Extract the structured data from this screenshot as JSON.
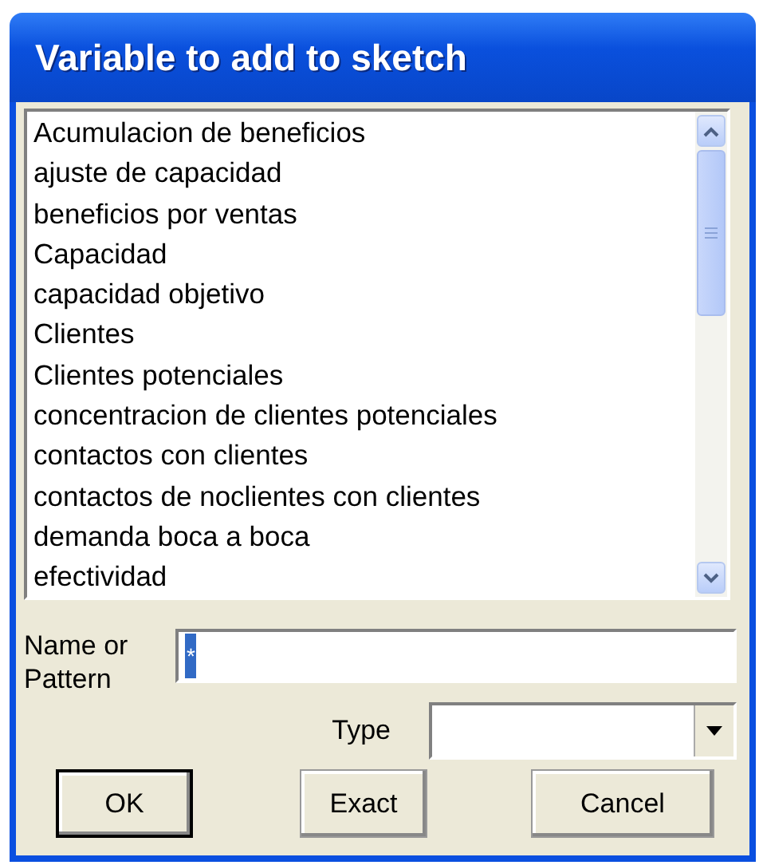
{
  "window": {
    "title": "Variable to add to sketch"
  },
  "variables": [
    {
      "label": "Acumulacion de beneficios",
      "selected": false
    },
    {
      "label": "ajuste de capacidad",
      "selected": false
    },
    {
      "label": "beneficios por ventas",
      "selected": false
    },
    {
      "label": "Capacidad",
      "selected": false
    },
    {
      "label": "capacidad objetivo",
      "selected": false
    },
    {
      "label": "Clientes",
      "selected": false
    },
    {
      "label": "Clientes potenciales",
      "selected": false
    },
    {
      "label": "concentracion de clientes potenciales",
      "selected": false
    },
    {
      "label": "contactos con clientes",
      "selected": false
    },
    {
      "label": "contactos de noclientes con clientes",
      "selected": false
    },
    {
      "label": "demanda boca a boca",
      "selected": false
    },
    {
      "label": "efectividad",
      "selected": false
    }
  ],
  "name_field": {
    "label": "Name or Pattern",
    "value": "*"
  },
  "type_field": {
    "label": "Type"
  },
  "buttons": [
    {
      "label": "OK",
      "default": true
    },
    {
      "label": "Exact",
      "default": false
    },
    {
      "label": "Cancel",
      "default": false
    }
  ]
}
